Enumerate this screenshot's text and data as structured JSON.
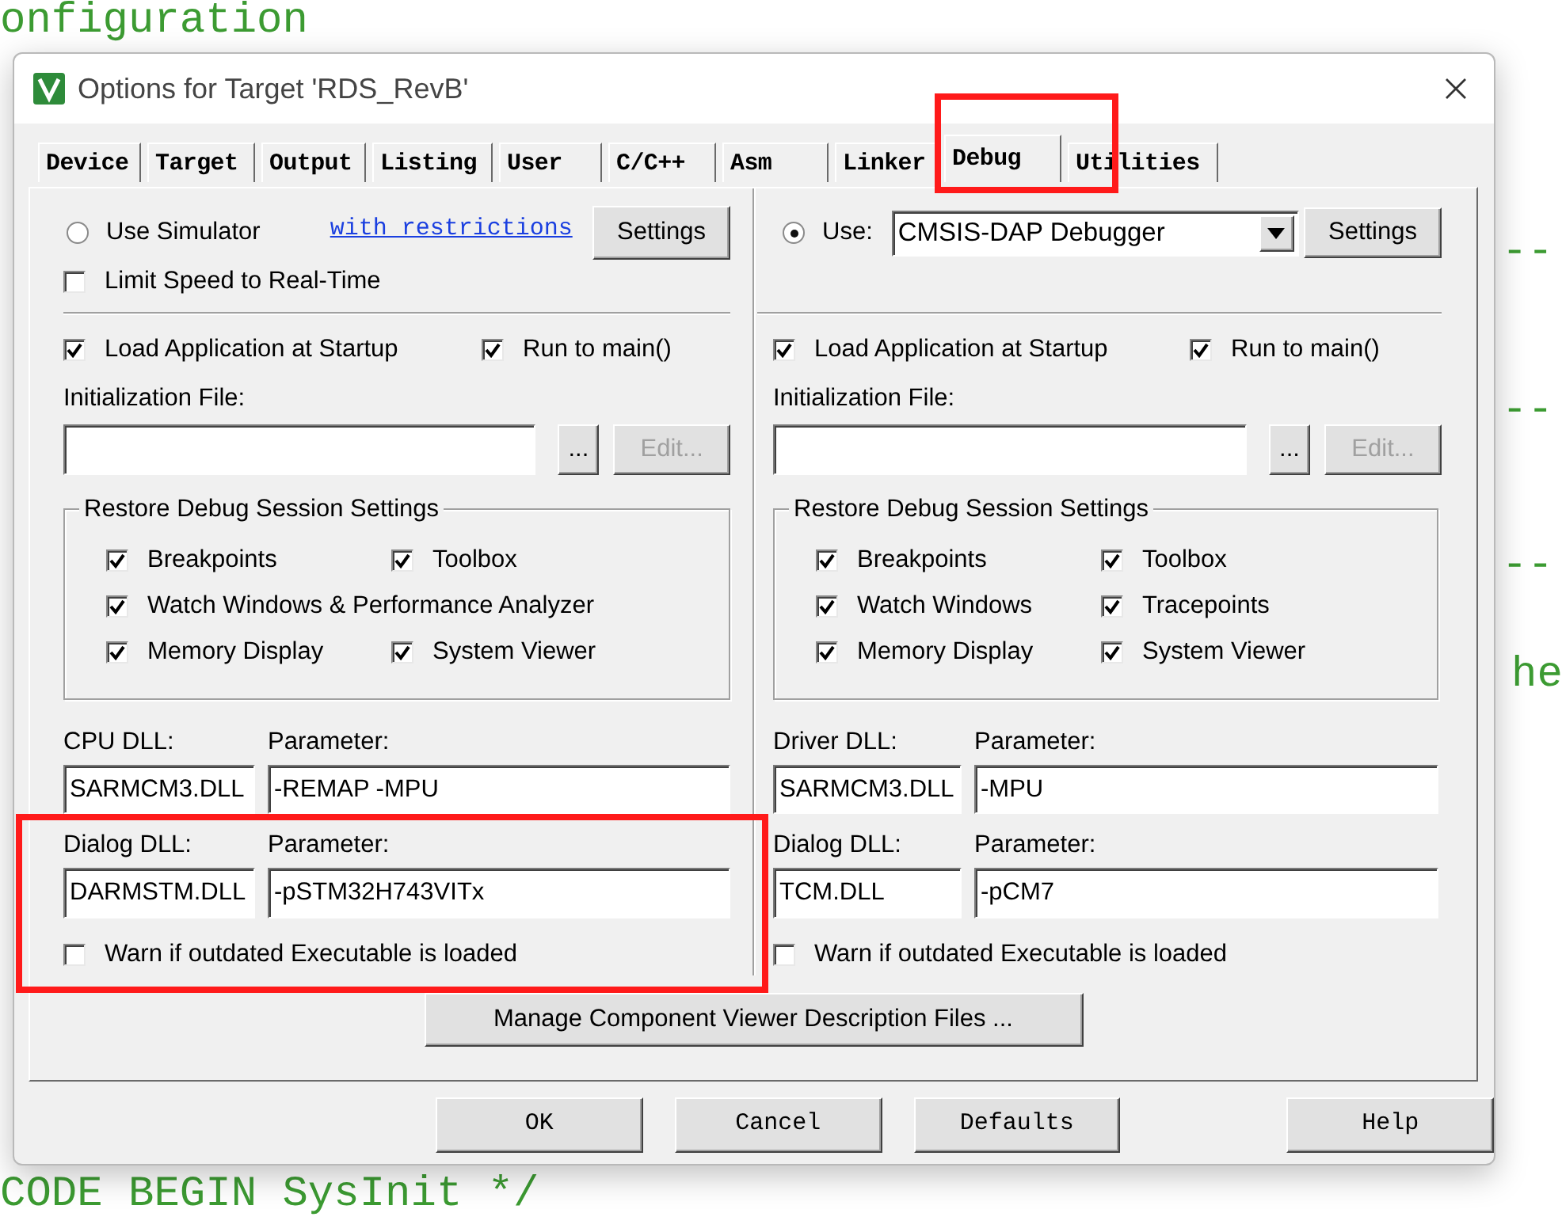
{
  "editor": {
    "fragments": [
      {
        "text": "onfiguration",
        "kind": "comment"
      },
      {
        "text": "--",
        "kind": "comment"
      },
      {
        "text": "--",
        "kind": "comment"
      },
      {
        "text": "--",
        "kind": "comment"
      },
      {
        "text": "he",
        "kind": "comment"
      },
      {
        "text": "CODE BEGIN SysInit */",
        "kind": "comment"
      }
    ]
  },
  "dialog": {
    "title": "Options for Target 'RDS_RevB'",
    "tabs": [
      {
        "label": "Device",
        "selected": false,
        "highlighted": false
      },
      {
        "label": "Target",
        "selected": false,
        "highlighted": false
      },
      {
        "label": "Output",
        "selected": false,
        "highlighted": false
      },
      {
        "label": "Listing",
        "selected": false,
        "highlighted": false
      },
      {
        "label": "User",
        "selected": false,
        "highlighted": false
      },
      {
        "label": "C/C++",
        "selected": false,
        "highlighted": false
      },
      {
        "label": "Asm",
        "selected": false,
        "highlighted": false
      },
      {
        "label": "Linker",
        "selected": false,
        "highlighted": false
      },
      {
        "label": "Debug",
        "selected": true,
        "highlighted": true
      },
      {
        "label": "Utilities",
        "selected": false,
        "highlighted": false
      }
    ],
    "panels": [
      {
        "kind": "simulator",
        "mode": {
          "label": "Use Simulator",
          "selected": false
        },
        "link": "with restrictions",
        "settings": "Settings",
        "limit_speed": {
          "label": "Limit Speed to Real-Time",
          "checked": false
        },
        "load_app": {
          "label": "Load Application at Startup",
          "checked": true
        },
        "run_to_main": {
          "label": "Run to main()",
          "checked": true
        },
        "init_file": {
          "label": "Initialization File:",
          "browse": "...",
          "edit": "Edit...",
          "edit_disabled": true
        },
        "restore": {
          "title": "Restore Debug Session Settings",
          "rows": [
            [
              {
                "label": "Breakpoints",
                "checked": true
              },
              {
                "label": "Toolbox",
                "checked": true
              }
            ],
            [
              {
                "label": "Watch Windows & Performance Analyzer",
                "checked": true
              }
            ],
            [
              {
                "label": "Memory Display",
                "checked": true
              },
              {
                "label": "System Viewer",
                "checked": true
              }
            ]
          ]
        },
        "dll": {
          "label": "CPU DLL:",
          "value": "SARMCM3.DLL",
          "param_label": "Parameter:",
          "param": "-REMAP -MPU"
        },
        "dialog_section": {
          "highlighted": true,
          "label": "Dialog DLL:",
          "value": "DARMSTM.DLL",
          "param_label": "Parameter:",
          "param": "-pSTM32H743VITx",
          "warn": {
            "label": "Warn if outdated Executable is loaded",
            "checked": false
          }
        }
      },
      {
        "kind": "target",
        "mode": {
          "label": "Use:",
          "selected": true
        },
        "debugger": "CMSIS-DAP Debugger",
        "settings": "Settings",
        "load_app": {
          "label": "Load Application at Startup",
          "checked": true
        },
        "run_to_main": {
          "label": "Run to main()",
          "checked": true
        },
        "init_file": {
          "label": "Initialization File:",
          "browse": "...",
          "edit": "Edit...",
          "edit_disabled": true
        },
        "restore": {
          "title": "Restore Debug Session Settings",
          "rows": [
            [
              {
                "label": "Breakpoints",
                "checked": true
              },
              {
                "label": "Toolbox",
                "checked": true
              }
            ],
            [
              {
                "label": "Watch Windows",
                "checked": true
              },
              {
                "label": "Tracepoints",
                "checked": true
              }
            ],
            [
              {
                "label": "Memory Display",
                "checked": true
              },
              {
                "label": "System Viewer",
                "checked": true
              }
            ]
          ]
        },
        "dll": {
          "label": "Driver DLL:",
          "value": "SARMCM3.DLL",
          "param_label": "Parameter:",
          "param": "-MPU"
        },
        "dialog_section": {
          "highlighted": false,
          "label": "Dialog DLL:",
          "value": "TCM.DLL",
          "param_label": "Parameter:",
          "param": "-pCM7",
          "warn": {
            "label": "Warn if outdated Executable is loaded",
            "checked": false
          }
        }
      }
    ],
    "manage_button": "Manage Component Viewer Description Files ...",
    "buttons": [
      "OK",
      "Cancel",
      "Defaults",
      "Help"
    ]
  }
}
